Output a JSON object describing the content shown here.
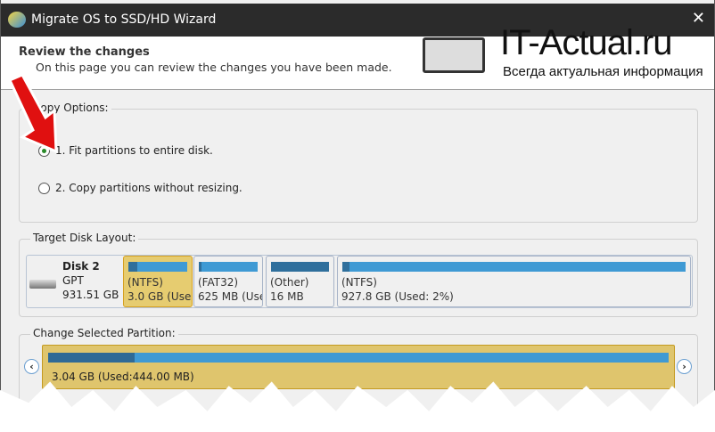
{
  "window": {
    "title": "Migrate OS to SSD/HD Wizard",
    "close": "✕"
  },
  "header": {
    "title": "Review the changes",
    "subtitle": "On this page you can review the changes you have been made."
  },
  "watermark": {
    "title": "IT-Actual.ru",
    "tagline": "Всегда актуальная информация"
  },
  "copy_options": {
    "legend": "Copy Options:",
    "options": [
      {
        "label": "1. Fit partitions to entire disk.",
        "selected": true
      },
      {
        "label": "2. Copy partitions without resizing.",
        "selected": false
      }
    ]
  },
  "target_layout": {
    "legend": "Target Disk Layout:",
    "disk": {
      "name": "Disk 2",
      "type": "GPT",
      "size": "931.51 GB"
    },
    "partitions": [
      {
        "fs": "(NTFS)",
        "size": "3.0 GB (Used",
        "used_pct": 15,
        "selected": true
      },
      {
        "fs": "(FAT32)",
        "size": "625 MB (Use",
        "used_pct": 5,
        "selected": false
      },
      {
        "fs": "(Other)",
        "size": "16 MB",
        "used_pct": 100,
        "selected": false
      },
      {
        "fs": "(NTFS)",
        "size": "927.8 GB (Used: 2%)",
        "used_pct": 2,
        "selected": false
      }
    ]
  },
  "change_partition": {
    "legend": "Change Selected Partition:",
    "label": "3.04 GB (Used:444.00 MB)",
    "used_pct": 14,
    "prev": "‹",
    "next": "›"
  }
}
